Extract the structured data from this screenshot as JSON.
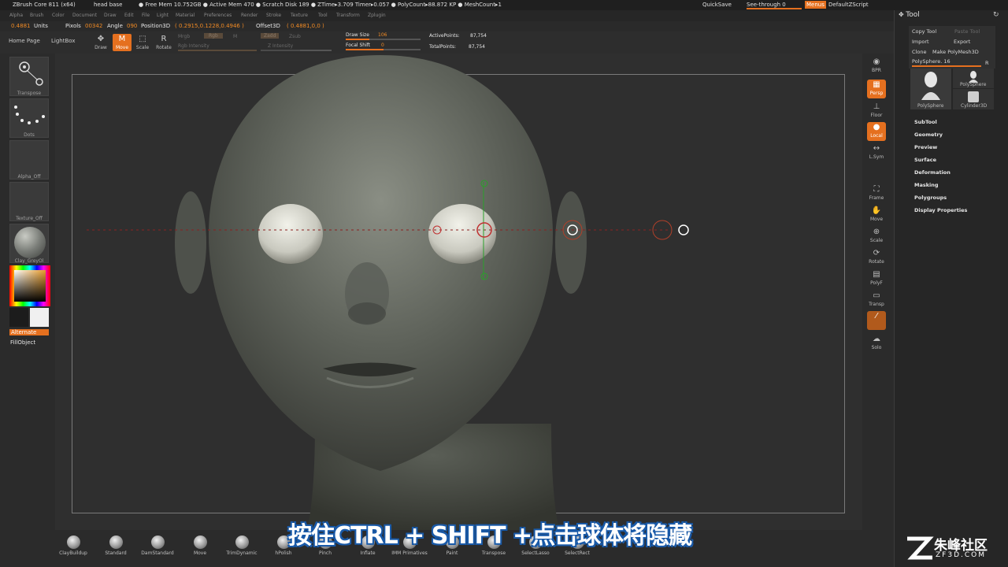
{
  "titlebar": {
    "app": "ZBrush Core 811 (x64)",
    "doc": "head base",
    "stats": "● Free Mem 10.752GB ● Active Mem 470 ● Scratch Disk 189 ● ZTime▸3.709 Timer▸0.057 ● PolyCount▸88.872 KP ● MeshCount▸1",
    "quicksave": "QuickSave",
    "seethrough": "See-through  0",
    "menus": "Menus",
    "script": "DefaultZScript"
  },
  "menu_items": [
    "Alpha",
    "Brush",
    "Color",
    "Document",
    "Draw",
    "Edit",
    "File",
    "Light",
    "Material",
    "Preferences",
    "Render",
    "Stroke",
    "Texture",
    "Tool",
    "Transform",
    "Zplugin"
  ],
  "info_row": {
    "units_val": "0.4881",
    "units_lbl": "Units",
    "pixols_lbl": "Pixols",
    "pixols_val": "00342",
    "angle_lbl": "Angle",
    "angle_val": "090",
    "pos_lbl": "Position3D",
    "pos_val": "( 0.2915,0.1228,0.4946 )",
    "offset_lbl": "Offset3D",
    "offset_val": "( 0.4881,0,0 )"
  },
  "shelf": {
    "home": "Home Page",
    "lightbox": "LightBox",
    "draw": "Draw",
    "move": "Move",
    "scale": "Scale",
    "rotate": "Rotate",
    "mrgb": "Mrgb",
    "rgb": "Rgb",
    "m": "M",
    "zadd": "Zadd",
    "zsub": "Zsub",
    "rgb_intensity": "Rgb Intensity",
    "z_intensity": "Z Intensity",
    "draw_size_lbl": "Draw Size",
    "draw_size_val": "106",
    "draw_size_level": 0.32,
    "focal_lbl": "Focal Shift",
    "focal_val": "0",
    "focal_level": 0.5,
    "active_points_lbl": "ActivePoints:",
    "active_points_val": "87,754",
    "total_points_lbl": "TotalPoints:",
    "total_points_val": "87,754"
  },
  "left_tray": [
    "Transpose",
    "Dots",
    "Alpha_Off",
    "Texture_Off",
    "Clay_GreyOl"
  ],
  "left_extra": {
    "alternate": "Alternate",
    "fillobject": "FillObject"
  },
  "right_tray": [
    "BPR",
    "Persp",
    "Floor",
    "Local",
    "L.Sym",
    "Frame",
    "Move",
    "Scale",
    "Rotate",
    "PolyF",
    "Transp",
    "Solo"
  ],
  "tool_panel": {
    "title": "Tool",
    "copy_tool": "Copy Tool",
    "paste_tool": "Paste Tool",
    "import": "Import",
    "export": "Export",
    "clone": "Clone",
    "make_polymesh": "Make PolyMesh3D",
    "current_tool": "PolySphere. 16",
    "r": "R",
    "thumbs": [
      "PolySphere",
      "PolySphere",
      "Cylinder3D"
    ],
    "sections": [
      "SubTool",
      "Geometry",
      "Preview",
      "Surface",
      "Deformation",
      "Masking",
      "Polygroups",
      "Display Properties"
    ]
  },
  "brushes": [
    "ClayBuildup",
    "Standard",
    "DamStandard",
    "Move",
    "TrimDynamic",
    "hPolish",
    "Pinch",
    "Inflate",
    "IMM Primatives",
    "Paint",
    "Transpose",
    "SelectLasso",
    "SelectRect"
  ],
  "subtitle": "按住CTRL + SHIFT +点击球体将隐藏",
  "watermark": {
    "brand": "朱峰社区",
    "url": "ZF3D.COM"
  },
  "colors": {
    "accent": "#e5701f",
    "subtitle_outline": "#1a5aa8"
  }
}
